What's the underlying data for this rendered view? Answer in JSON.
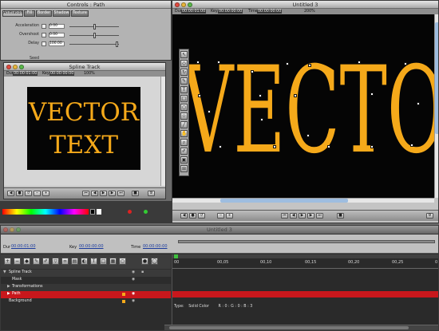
{
  "controls_window": {
    "title": "Controls : Path",
    "tabs": [
      "Animation",
      "Fill",
      "Border",
      "Shadow",
      "Texture"
    ],
    "active_tab": "Animation",
    "properties": [
      {
        "label": "Acceleration",
        "value": "0.00"
      },
      {
        "label": "Overshoot",
        "value": "0.00"
      },
      {
        "label": "Delay",
        "value": "100.00"
      }
    ],
    "seed_label": "Seed"
  },
  "spline_window": {
    "title": "Spline Track",
    "dur_label": "Dur",
    "dur_value": "00:00:01:00",
    "key_label": "Key",
    "key_value": "00:00:00:00",
    "zoom": "100%",
    "preview_lines": [
      "VECTOR",
      "TEXT"
    ]
  },
  "canvas_window": {
    "title": "Untitled 3",
    "dur_label": "Dur",
    "dur_value": "00:00:01:00",
    "key_label": "Key",
    "key_value": "00:00:00:00",
    "time_label": "Time",
    "time_value": "00:00:00:00",
    "zoom": "200%",
    "canvas_text": "VECTO",
    "accent_color": "#f5a91a"
  },
  "timeline_window": {
    "title": "Untitled 3",
    "dur_label": "Dur",
    "dur_value": "00:00:01:00",
    "key_label": "Key",
    "key_value": "00:00:00:00",
    "time_label": "Time",
    "time_value": "00:00:00:00",
    "ruler_ticks": [
      "00",
      "00,05",
      "00,10",
      "00,15",
      "00,20",
      "00,25",
      "0"
    ],
    "tracks": [
      {
        "label": "Spline Track",
        "indent": 0,
        "selected": false
      },
      {
        "label": "Mask",
        "indent": 1,
        "selected": false
      },
      {
        "label": "Transformations",
        "indent": 1,
        "selected": false
      },
      {
        "label": "Path",
        "indent": 1,
        "selected": true
      },
      {
        "label": "Background",
        "indent": 0,
        "selected": false
      }
    ],
    "type_label": "Type",
    "type_value": "Solid Color",
    "color_readout": "R : 0 : G : 0 : B : 3",
    "selected_color": "#c8171c"
  }
}
